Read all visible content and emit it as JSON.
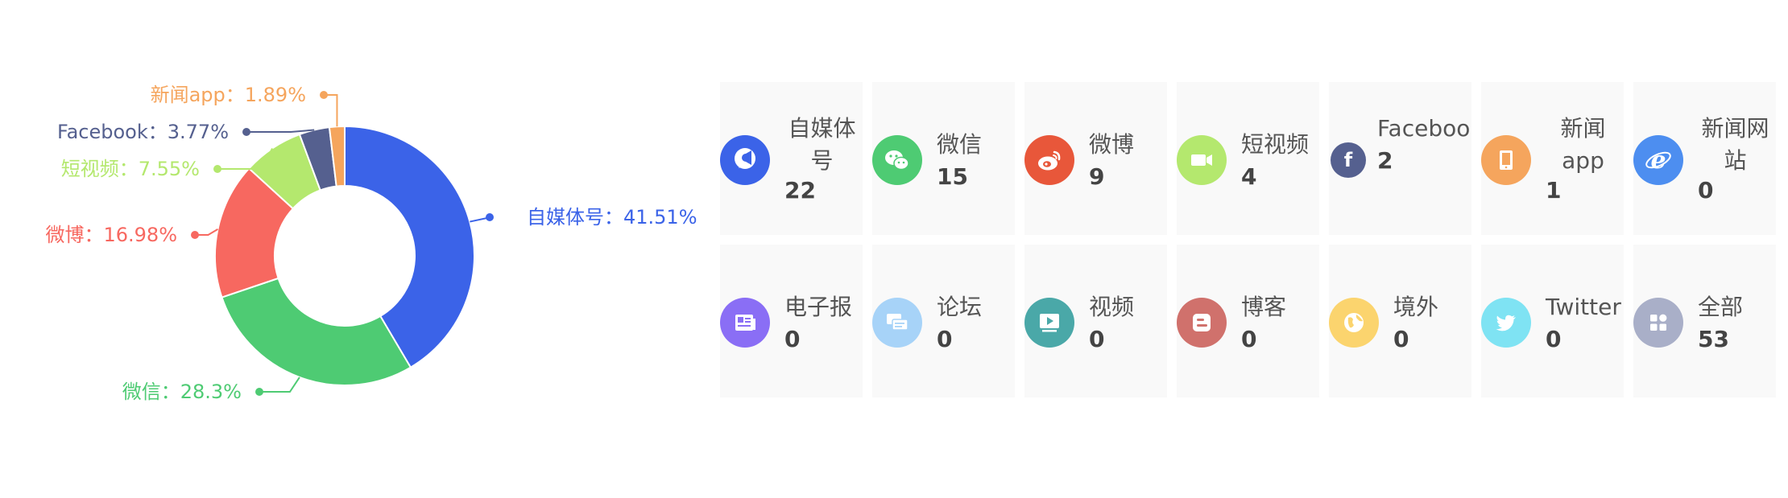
{
  "chart_data": {
    "type": "pie",
    "donut": true,
    "slices": [
      {
        "name": "自媒体号",
        "value": 41.51,
        "label": "自媒体号：41.51%",
        "color": "#3b63e8"
      },
      {
        "name": "微信",
        "value": 28.3,
        "label": "微信：28.3%",
        "color": "#4ecb73"
      },
      {
        "name": "微博",
        "value": 16.98,
        "label": "微博：16.98%",
        "color": "#f76860"
      },
      {
        "name": "短视频",
        "value": 7.55,
        "label": "短视频：7.55%",
        "color": "#b4e86e"
      },
      {
        "name": "Facebook",
        "value": 3.77,
        "label": "Facebook：3.77%",
        "color": "#55608f"
      },
      {
        "name": "新闻app",
        "value": 1.89,
        "label": "新闻app：1.89%",
        "color": "#f5a55d"
      }
    ]
  },
  "cards": [
    {
      "name": "自媒体",
      "name2": "号",
      "count": "22",
      "icon": "megaphone-icon",
      "color": "#3b63e8"
    },
    {
      "name": "微信",
      "count": "15",
      "icon": "wechat-icon",
      "color": "#4ecb73"
    },
    {
      "name": "微博",
      "count": "9",
      "icon": "weibo-icon",
      "color": "#e8573a"
    },
    {
      "name": "短视频",
      "count": "4",
      "icon": "video-camera-icon",
      "color": "#b4e86e"
    },
    {
      "name": "Facebook",
      "count": "2",
      "icon": "facebook-icon",
      "color": "#55608f"
    },
    {
      "name": "新闻",
      "name2": "app",
      "count": "1",
      "icon": "mobile-phone-icon",
      "color": "#f5a55d"
    },
    {
      "name": "新闻网",
      "name2": "站",
      "count": "0",
      "icon": "internet-explorer-icon",
      "color": "#4d8ef0"
    },
    {
      "name": "电子报",
      "count": "0",
      "icon": "newspaper-icon",
      "color": "#8a6ef5"
    },
    {
      "name": "论坛",
      "count": "0",
      "icon": "forum-chat-icon",
      "color": "#a7d3f8"
    },
    {
      "name": "视频",
      "count": "0",
      "icon": "play-screen-icon",
      "color": "#4aa8a8"
    },
    {
      "name": "博客",
      "count": "0",
      "icon": "blog-icon",
      "color": "#d0716c"
    },
    {
      "name": "境外",
      "count": "0",
      "icon": "globe-icon",
      "color": "#fbd46e"
    },
    {
      "name": "Twitter",
      "count": "0",
      "icon": "twitter-icon",
      "color": "#7fe3f3"
    },
    {
      "name": "全部",
      "count": "53",
      "icon": "apps-grid-icon",
      "color": "#a9afc8"
    }
  ]
}
